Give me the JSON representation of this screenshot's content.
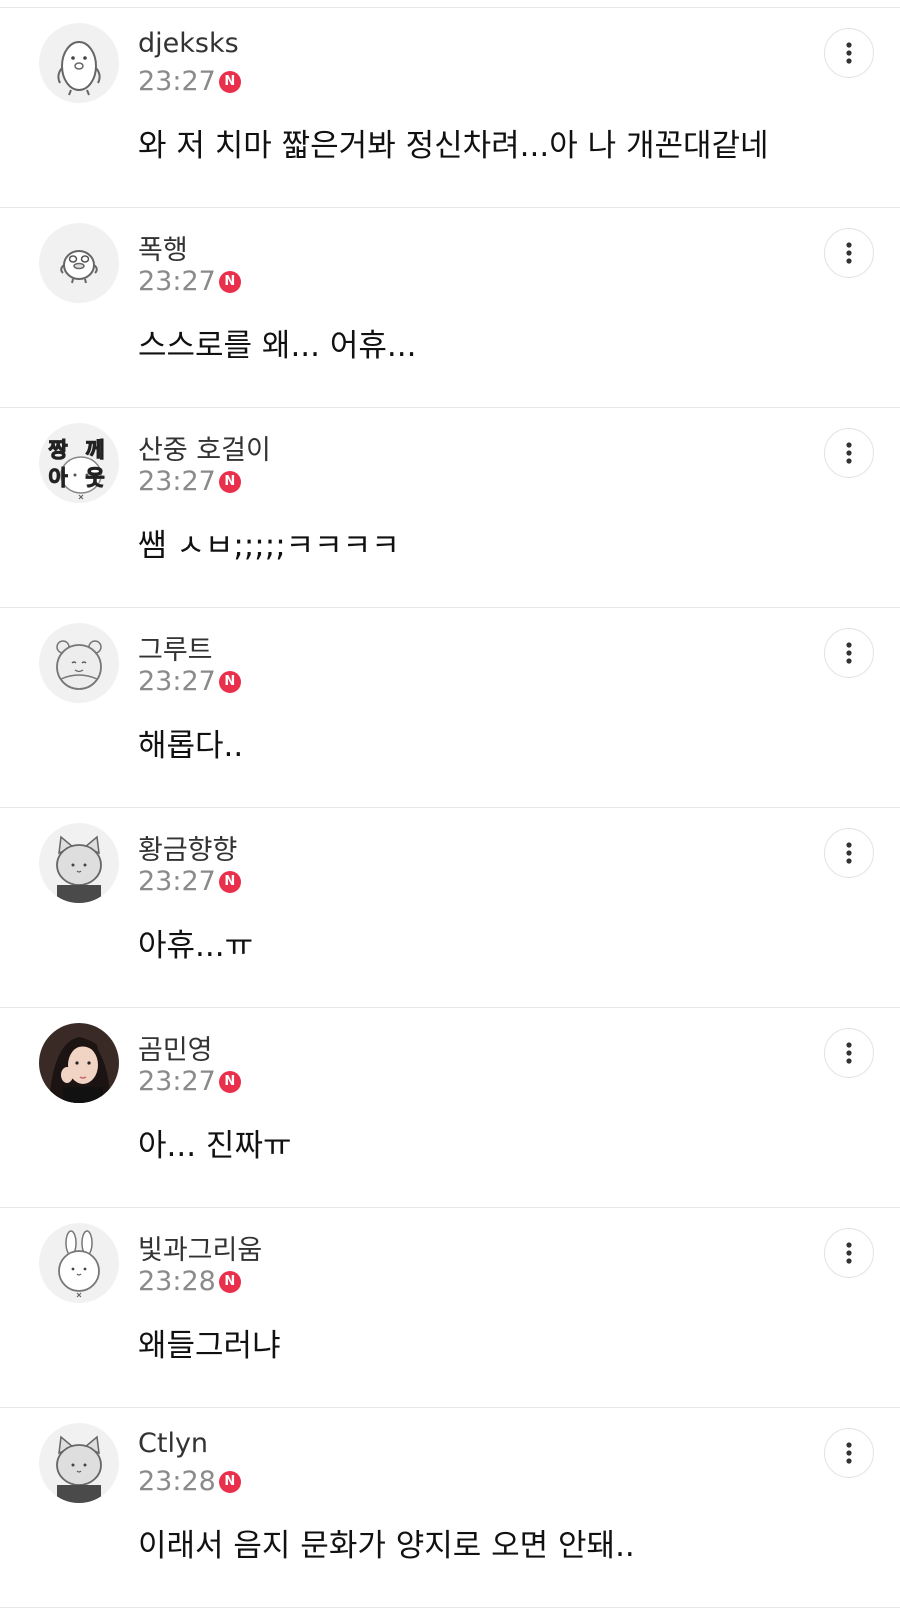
{
  "colors": {
    "new_badge": "#e8304a",
    "time_text": "#8a8a8a",
    "divider": "#e6e6e6"
  },
  "comments": [
    {
      "nickname": "djeksks",
      "time": "23:27",
      "badge": "N",
      "text": "와 저 치마 짧은거봐 정신차려...아 나 개꼰대같네",
      "avatar_icon": "penguin-avatar-icon"
    },
    {
      "nickname": "폭행",
      "time": "23:27",
      "badge": "N",
      "text": "스스로를 왜... 어휴...",
      "avatar_icon": "duck-avatar-icon"
    },
    {
      "nickname": "산중 호걸이",
      "time": "23:27",
      "badge": "N",
      "text": "쌤 ㅅㅂ;;;;;ㅋㅋㅋㅋ",
      "avatar_icon": "sticker-text-avatar-icon",
      "avatar_text": [
        "짱",
        "께",
        "아",
        "웃"
      ]
    },
    {
      "nickname": "그루트",
      "time": "23:27",
      "badge": "N",
      "text": "해롭다..",
      "avatar_icon": "bear-avatar-icon"
    },
    {
      "nickname": "황금향향",
      "time": "23:27",
      "badge": "N",
      "text": "아휴...ㅠ",
      "avatar_icon": "cat-avatar-icon"
    },
    {
      "nickname": "곰민영",
      "time": "23:27",
      "badge": "N",
      "text": "아... 진짜ㅠ",
      "avatar_icon": "photo-avatar-icon"
    },
    {
      "nickname": "빛과그리움",
      "time": "23:28",
      "badge": "N",
      "text": "왜들그러냐",
      "avatar_icon": "rabbit-avatar-icon"
    },
    {
      "nickname": "Ctlyn",
      "time": "23:28",
      "badge": "N",
      "text": "이래서 음지 문화가 양지로 오면 안돼..",
      "avatar_icon": "cat-avatar-icon"
    }
  ]
}
